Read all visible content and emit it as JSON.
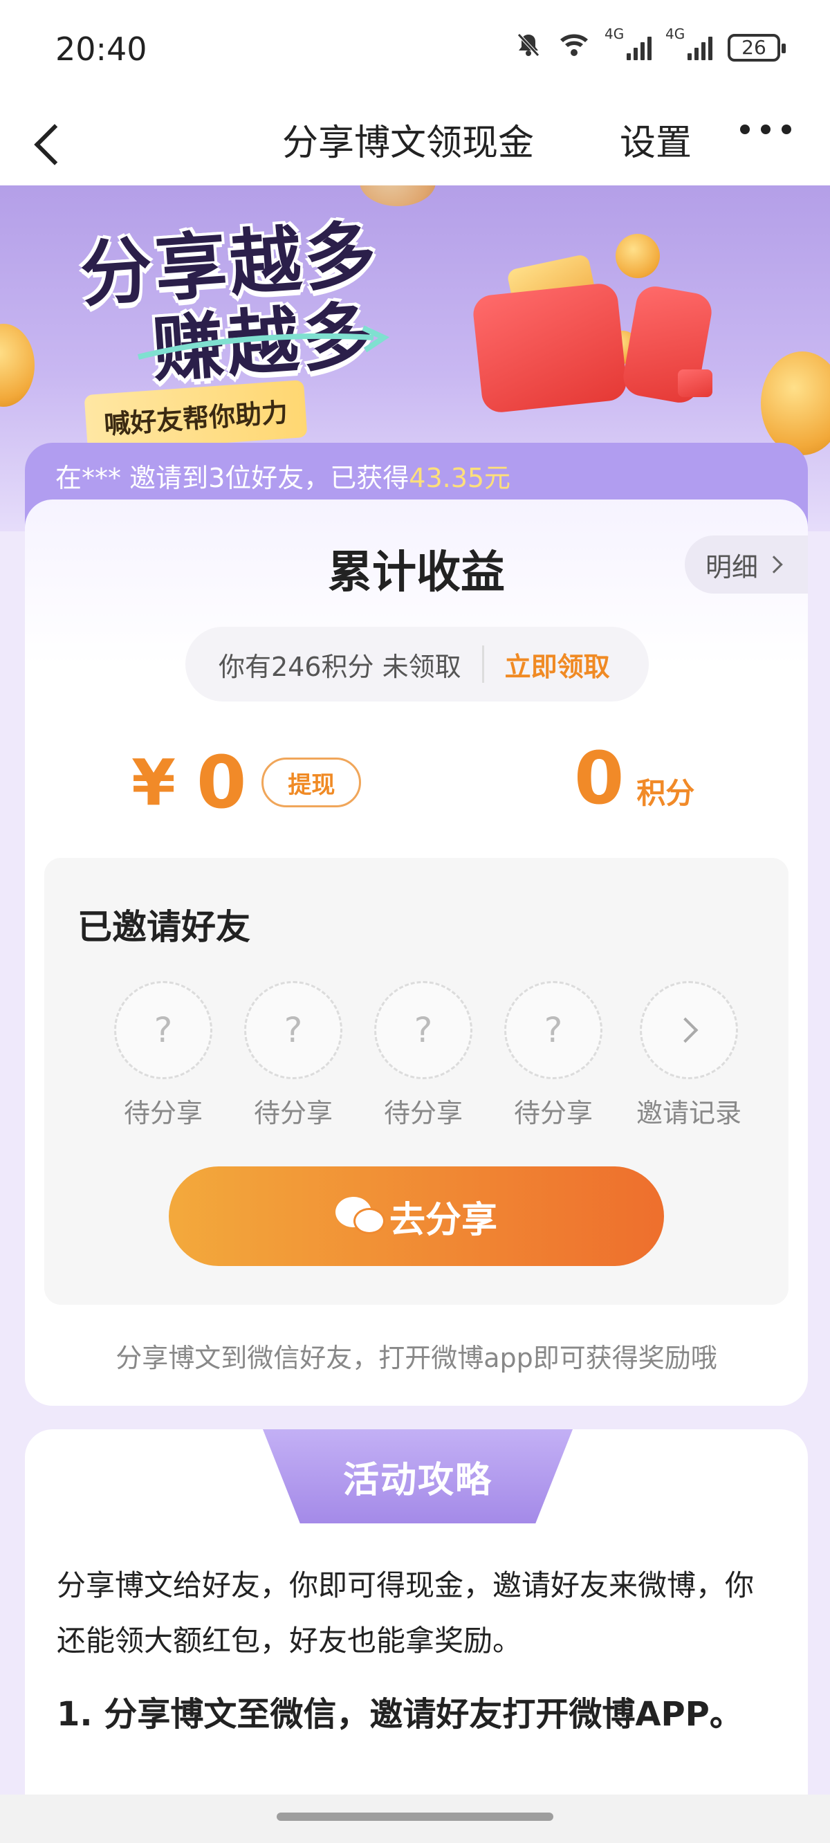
{
  "status_bar": {
    "time": "20:40",
    "battery": "26",
    "signal_labels": [
      "4G",
      "4G"
    ],
    "icons": [
      "bell-off-icon",
      "wifi-icon",
      "signal-icon",
      "signal-icon",
      "battery-icon"
    ]
  },
  "nav": {
    "title": "分享博文领现金",
    "settings": "设置",
    "icons": [
      "back-icon",
      "more-icon"
    ]
  },
  "banner": {
    "slogan_line1": "分享越多",
    "slogan_line2": "赚越多",
    "helper_tag": "喊好友帮你助力"
  },
  "ticker": {
    "prefix": "在*** 邀请到3位好友，已获得",
    "amount": "43.35元"
  },
  "earnings": {
    "title": "累计收益",
    "detail_label": "明细",
    "points_notice": "你有246积分 未领取",
    "claim_label": "立即领取",
    "cash_symbol": "¥",
    "cash_value": "0",
    "withdraw_label": "提现",
    "points_value": "0",
    "points_unit": "积分"
  },
  "invite": {
    "title": "已邀请好友",
    "slots": [
      {
        "mark": "?",
        "label": "待分享"
      },
      {
        "mark": "?",
        "label": "待分享"
      },
      {
        "mark": "?",
        "label": "待分享"
      },
      {
        "mark": "?",
        "label": "待分享"
      }
    ],
    "record_label": "邀请记录",
    "share_label": "去分享",
    "hint": "分享博文到微信好友，打开微博app即可获得奖励哦"
  },
  "strategy": {
    "tab_label": "活动攻略",
    "body": "分享博文给好友，你即可得现金，邀请好友来微博，你还能领大额红包，好友也能拿奖励。",
    "step1": "1. 分享博文至微信，邀请好友打开微博APP。"
  },
  "colors": {
    "accent_orange": "#f18a28",
    "banner_purple": "#b49fe8",
    "ticker_amount": "#ffe07a"
  }
}
